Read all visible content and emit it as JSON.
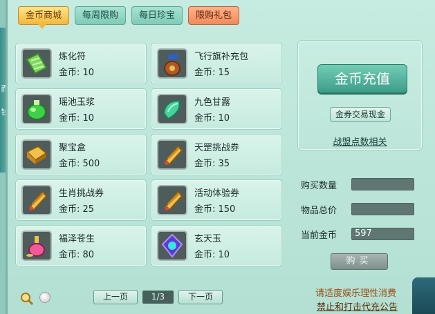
{
  "side_labels": [
    "而",
    "钱"
  ],
  "tabs": [
    {
      "label": "金币商城"
    },
    {
      "label": "每周限购"
    },
    {
      "label": "每日珍宝"
    },
    {
      "label": "限购礼包"
    }
  ],
  "items": [
    {
      "name": "炼化符",
      "price": "金币: 10",
      "icon": "talisman-icon"
    },
    {
      "name": "飞行旗补充包",
      "price": "金币: 15",
      "icon": "flag-pouch-icon"
    },
    {
      "name": "瑶池玉浆",
      "price": "金币: 10",
      "icon": "jade-liquid-icon"
    },
    {
      "name": "九色甘露",
      "price": "金币: 10",
      "icon": "nectar-icon"
    },
    {
      "name": "聚宝盒",
      "price": "金币: 500",
      "icon": "treasure-box-icon"
    },
    {
      "name": "天罡挑战券",
      "price": "金币: 35",
      "icon": "scroll-icon"
    },
    {
      "name": "生肖挑战券",
      "price": "金币: 25",
      "icon": "scroll-icon"
    },
    {
      "name": "活动体验券",
      "price": "金币: 150",
      "icon": "scroll-icon"
    },
    {
      "name": "福泽苍生",
      "price": "金币: 80",
      "icon": "potion-icon"
    },
    {
      "name": "玄天玉",
      "price": "金币: 10",
      "icon": "jade-icon"
    }
  ],
  "recharge": {
    "button_label": "金币充值",
    "exchange_label": "金券交易现金",
    "league_link": "战盟点数相关"
  },
  "purchase": {
    "qty_label": "购买数量",
    "qty_value": "",
    "total_label": "物品总价",
    "total_value": "",
    "coins_label": "当前金币",
    "coins_value": "597",
    "buy_label": "购买"
  },
  "pager": {
    "prev_label": "上一页",
    "page": "1/3",
    "next_label": "下一页"
  },
  "notice": {
    "line1": "请适度娱乐理性消费",
    "line2": "禁止和打击代充公告"
  },
  "colors": {
    "panel": "#c6ebe0",
    "active_tab": "#f3b83b",
    "gift_tab": "#f08a5a",
    "recharge": "#3d9d88"
  }
}
